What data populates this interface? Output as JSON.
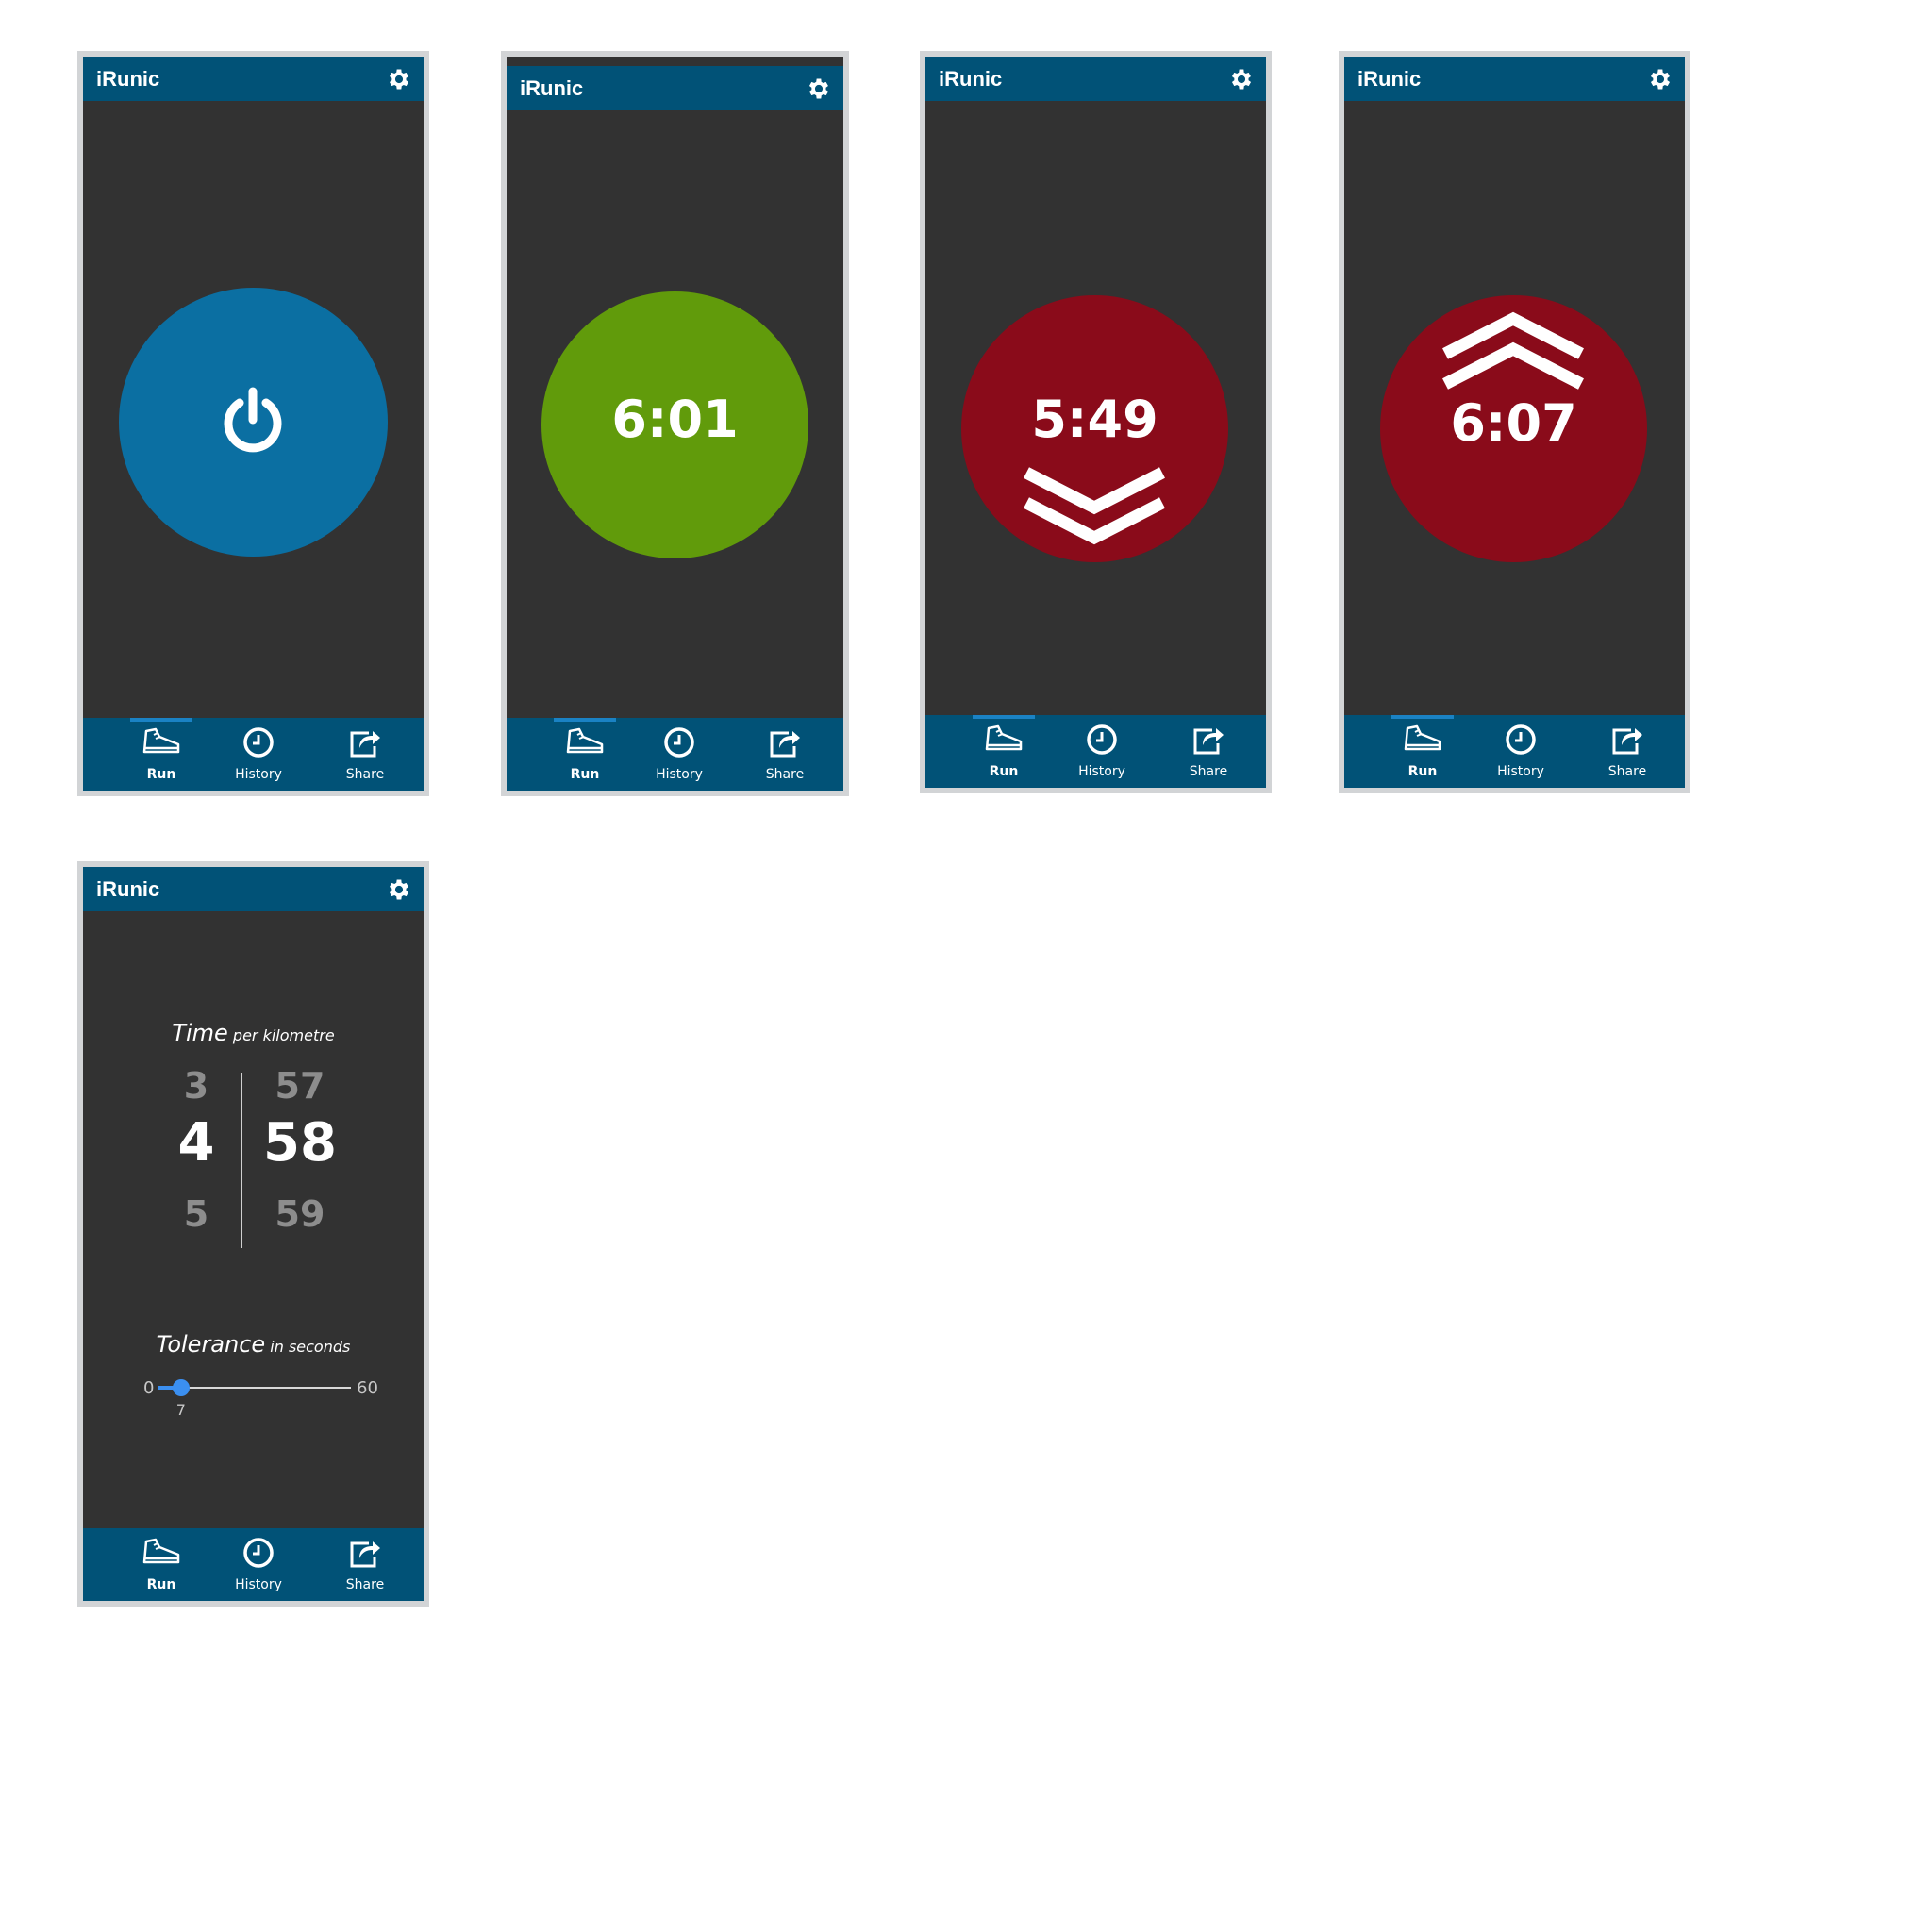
{
  "app": {
    "title": "iRunic"
  },
  "tabs": {
    "run": "Run",
    "history": "History",
    "share": "Share"
  },
  "screens": [
    {
      "id": "start",
      "state_color": "#0b6fa2"
    },
    {
      "id": "on-pace",
      "state_color": "#619b0b",
      "time": "6:01"
    },
    {
      "id": "slow-down",
      "state_color": "#8a0b1a",
      "time": "5:49"
    },
    {
      "id": "speed-up",
      "state_color": "#8a0b1a",
      "time": "6:07"
    }
  ],
  "settings": {
    "time_label": "Time",
    "time_unit": "per kilometre",
    "minutes": {
      "prev": "3",
      "selected": "4",
      "next": "5"
    },
    "seconds": {
      "prev": "57",
      "selected": "58",
      "next": "59"
    },
    "tolerance_label": "Tolerance",
    "tolerance_unit": "in seconds",
    "tolerance": {
      "min": "0",
      "max": "60",
      "value": "7"
    }
  },
  "colors": {
    "header": "#015277",
    "screen_bg": "#323232",
    "frame": "#d2d4d6",
    "slider": "#3b8ff0",
    "active_tab": "#1a82c4"
  }
}
